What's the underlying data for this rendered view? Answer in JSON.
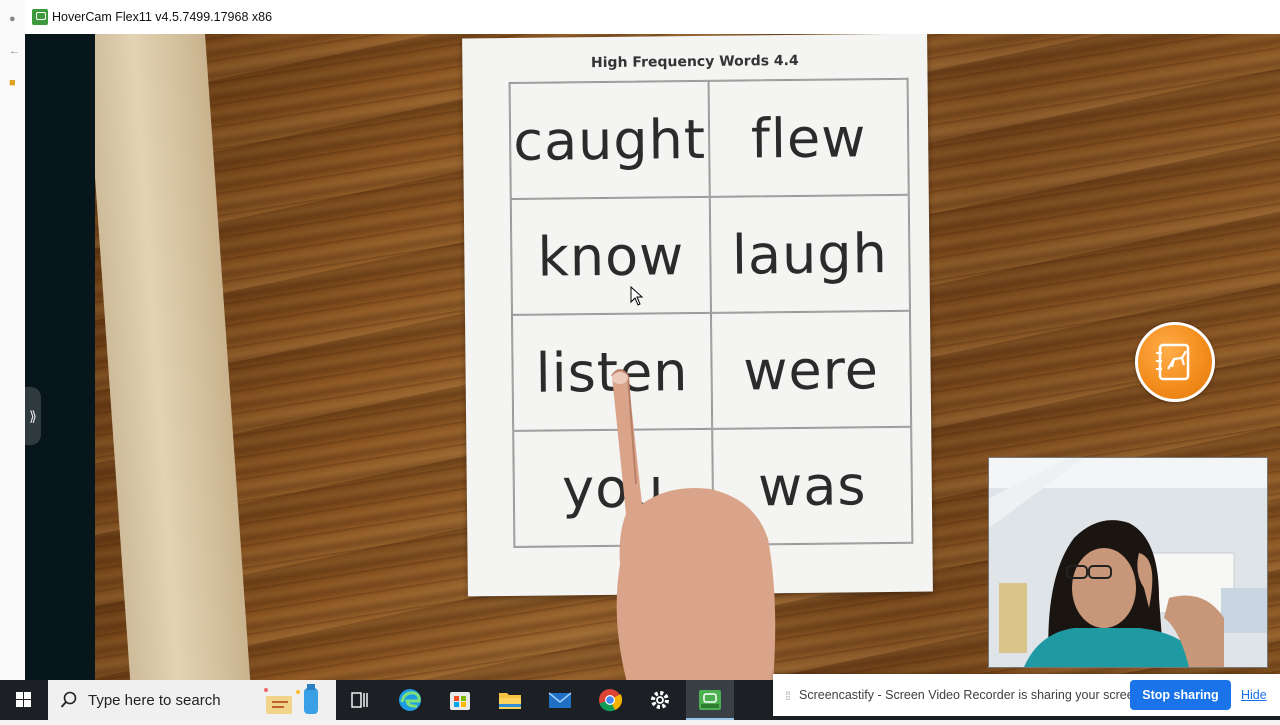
{
  "window": {
    "title": "HoverCam Flex11 v4.5.7499.17968 x86"
  },
  "sidebar": {
    "expand_glyph": "⟫"
  },
  "worksheet": {
    "title": "High Frequency Words 4.4",
    "words": [
      "caught",
      "flew",
      "know",
      "laugh",
      "listen",
      "were",
      "you",
      "was"
    ]
  },
  "taskbar": {
    "search_placeholder": "Type here to search",
    "apps": [
      "task-view",
      "edge",
      "store",
      "file-explorer",
      "mail",
      "chrome",
      "settings",
      "hovercam-flex"
    ]
  },
  "share_bar": {
    "message": "Screencastify - Screen Video Recorder is sharing your screen.",
    "stop_label": "Stop sharing",
    "hide_label": "Hide"
  },
  "colors": {
    "accent_blue": "#1a73e8",
    "float_button": "#f28a1a",
    "taskbar": "#1c2025"
  }
}
